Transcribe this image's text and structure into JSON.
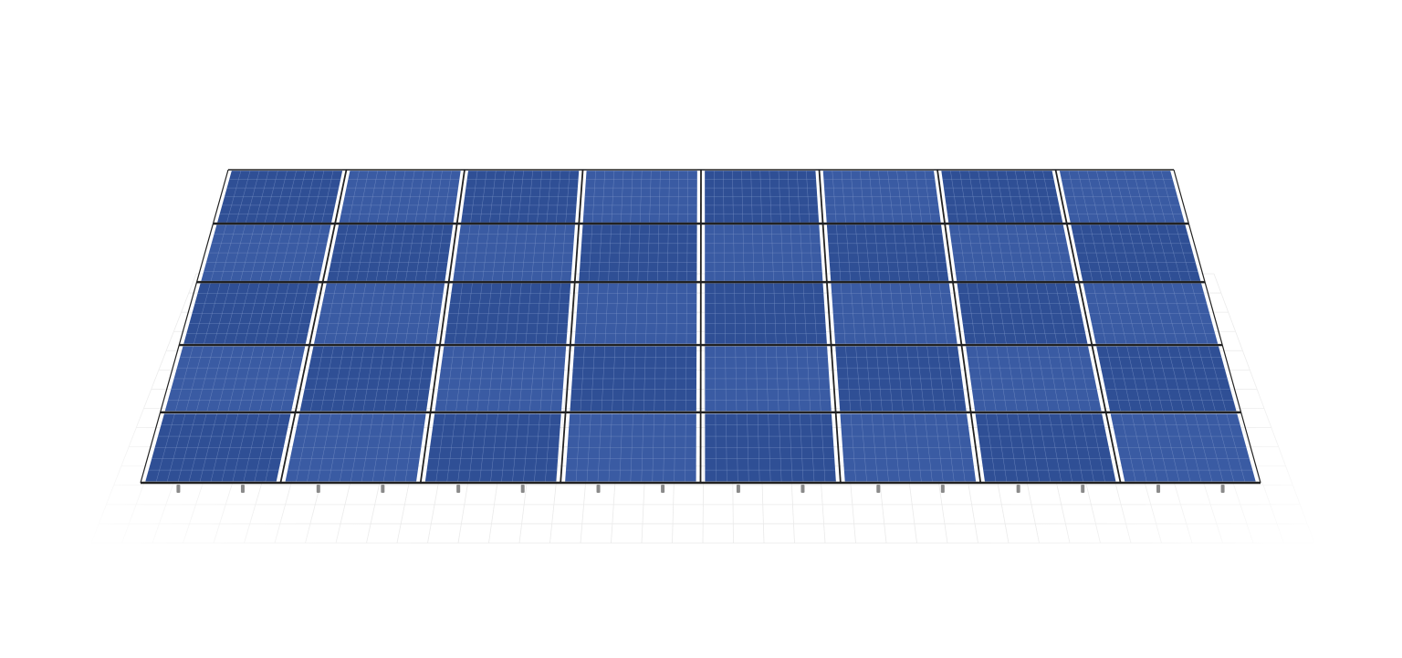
{
  "scene": {
    "subject": "solar-panel-array",
    "view": "perspective",
    "array": {
      "rows": 5,
      "columns": 8,
      "module_count": 40,
      "cells_per_module": {
        "across": 12,
        "down": 6
      }
    },
    "colors": {
      "background": "#ffffff",
      "module_fill": "#2f4f95",
      "module_fill_light": "#3a5ba3",
      "cell_line": "#7f97c9",
      "frame": "#222222",
      "mount_foot": "#8a8a8a",
      "ground_grid": "#e6e6e6"
    },
    "ground_grid_visible": true,
    "mount_feet_visible": true
  }
}
